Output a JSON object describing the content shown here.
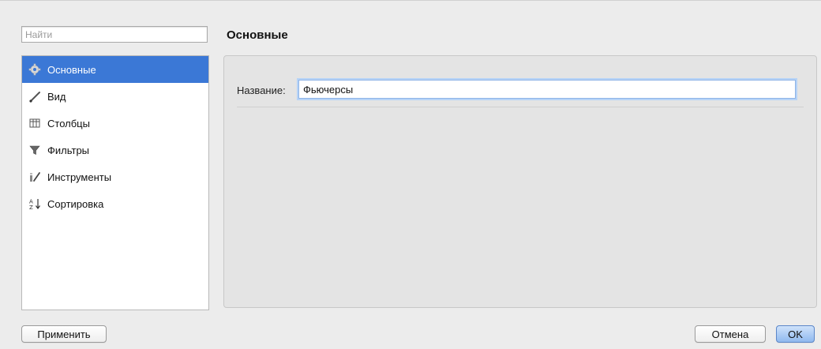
{
  "search": {
    "placeholder": "Найти",
    "value": ""
  },
  "sidebar": {
    "items": [
      {
        "label": "Основные",
        "icon": "gear-icon",
        "active": true
      },
      {
        "label": "Вид",
        "icon": "brush-icon",
        "active": false
      },
      {
        "label": "Столбцы",
        "icon": "columns-icon",
        "active": false
      },
      {
        "label": "Фильтры",
        "icon": "filter-icon",
        "active": false
      },
      {
        "label": "Инструменты",
        "icon": "tools-icon",
        "active": false
      },
      {
        "label": "Сортировка",
        "icon": "sort-az-icon",
        "active": false
      }
    ]
  },
  "main": {
    "title": "Основные",
    "name_field": {
      "label": "Название:",
      "value": "Фьючерсы"
    }
  },
  "footer": {
    "apply_label": "Применить",
    "cancel_label": "Отмена",
    "ok_label": "OK"
  },
  "colors": {
    "selection": "#3b78d6",
    "panel": "#e4e4e4",
    "background": "#ececec"
  }
}
